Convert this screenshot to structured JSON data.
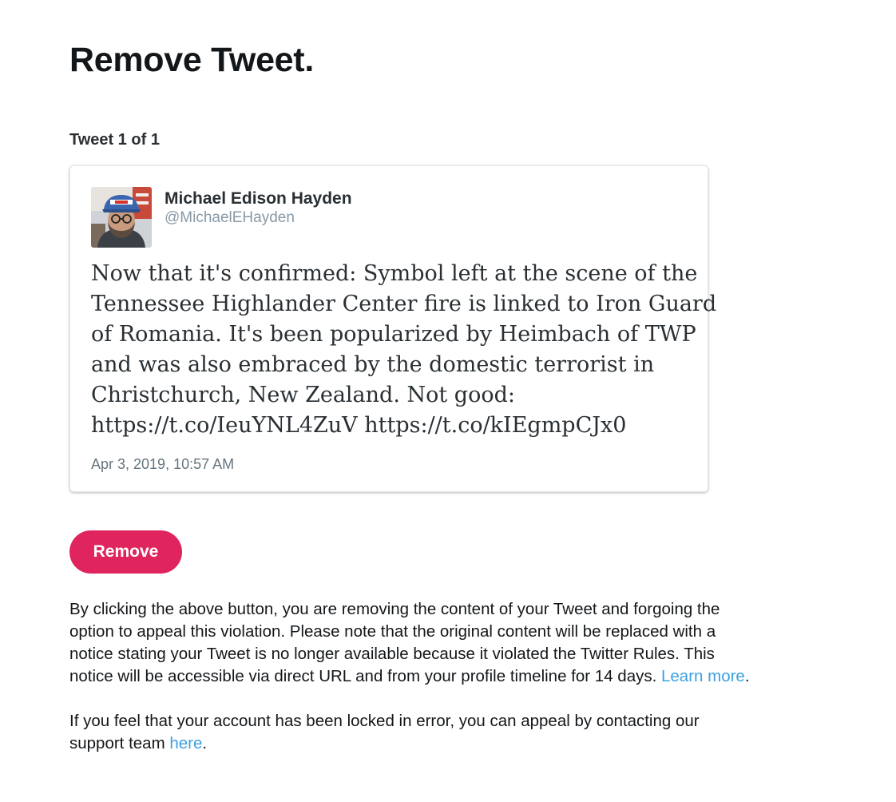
{
  "page": {
    "title": "Remove Tweet.",
    "tweet_counter": "Tweet 1 of 1"
  },
  "tweet": {
    "author_name": "Michael Edison Hayden",
    "author_handle": "@MichaelEHayden",
    "avatar_icon": "profile-photo-avatar",
    "text_lines": [
      "Now that it's confirmed: Symbol left at the scene of the",
      "Tennessee Highlander Center fire is linked to Iron Guard",
      "of Romania. It's been popularized by Heimbach of TWP",
      "and was also embraced by the domestic terrorist in",
      "Christchurch, New Zealand. Not good:",
      "https://t.co/IeuYNL4ZuV https://t.co/kIEgmpCJx0"
    ],
    "timestamp": "Apr 3, 2019, 10:57 AM"
  },
  "actions": {
    "remove_label": "Remove"
  },
  "notice": {
    "lines": [
      "By clicking the above button, you are removing the content of your Tweet and forgoing the",
      "option to appeal this violation. Please note that the original content will be replaced with a",
      "notice stating your Tweet is no longer available because it violated the Twitter Rules. This",
      "notice will be accessible via direct URL and from your profile timeline for 14 days."
    ],
    "learn_more_label": "Learn more",
    "learn_more_suffix": "."
  },
  "appeal": {
    "line1": "If you feel that your account has been locked in error, you can appeal by contacting our",
    "line2_prefix": "support team",
    "here_label": "here",
    "line2_suffix": "."
  },
  "colors": {
    "remove_button": "#e0245e",
    "link": "#3ba1e2",
    "handle_text": "#8899a6",
    "timestamp_text": "#66757f",
    "card_border": "#e1e8ed"
  }
}
